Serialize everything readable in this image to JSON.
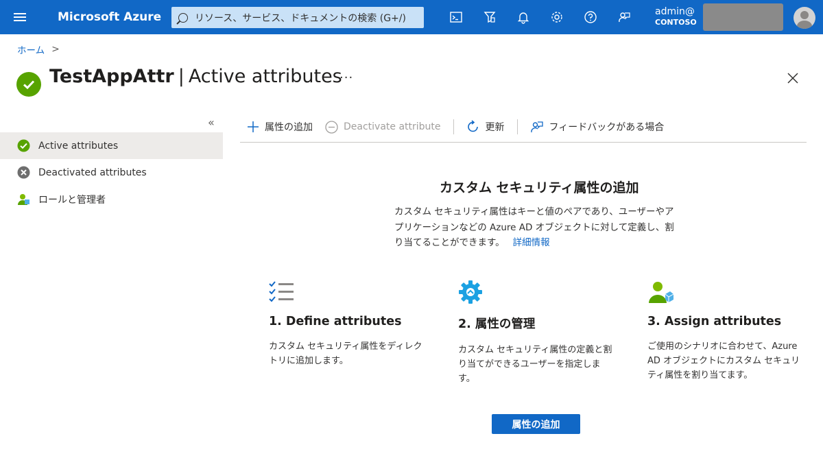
{
  "topbar": {
    "brand": "Microsoft Azure",
    "search_placeholder": "リソース、サービス、ドキュメントの検索 (G+/)",
    "account_user": "admin@",
    "account_tenant": "CONTOSO",
    "icons": [
      "cloud-shell-icon",
      "directory-filter-icon",
      "notifications-icon",
      "settings-icon",
      "help-icon",
      "feedback-icon"
    ]
  },
  "breadcrumb": {
    "home": "ホーム",
    "separator": ">"
  },
  "page": {
    "title_bold": "TestAppAttr",
    "title_sep": "|",
    "title_rest": "Active attributes",
    "more": "···"
  },
  "sidebar": {
    "collapse": "«",
    "items": [
      {
        "label": "Active attributes",
        "icon": "check-circle-icon",
        "active": true
      },
      {
        "label": "Deactivated attributes",
        "icon": "x-circle-icon",
        "active": false
      },
      {
        "label": "ロールと管理者",
        "icon": "user-role-icon",
        "active": false
      }
    ]
  },
  "toolbar": {
    "add": "属性の追加",
    "deactivate": "Deactivate attribute",
    "refresh": "更新",
    "feedback": "フィードバックがある場合"
  },
  "main": {
    "heading": "カスタム セキュリティ属性の追加",
    "description": "カスタム セキュリティ属性はキーと値のペアであり、ユーザーやアプリケーションなどの Azure AD オブジェクトに対して定義し、割り当てることができます。",
    "learn_more": "詳細情報",
    "steps": [
      {
        "title": "1. Define attributes",
        "text": "カスタム セキュリティ属性をディレクトリに追加します。"
      },
      {
        "title": "2. 属性の管理",
        "text": "カスタム セキュリティ属性の定義と割り当てができるユーザーを指定します。"
      },
      {
        "title": "3. Assign attributes",
        "text": "ご使用のシナリオに合わせて、Azure AD オブジェクトにカスタム セキュリティ属性を割り当てます。"
      }
    ],
    "primary_button": "属性の追加"
  },
  "colors": {
    "azure_blue": "#1168c6",
    "success_green": "#57a300",
    "search_bg": "#c9e1f7"
  }
}
